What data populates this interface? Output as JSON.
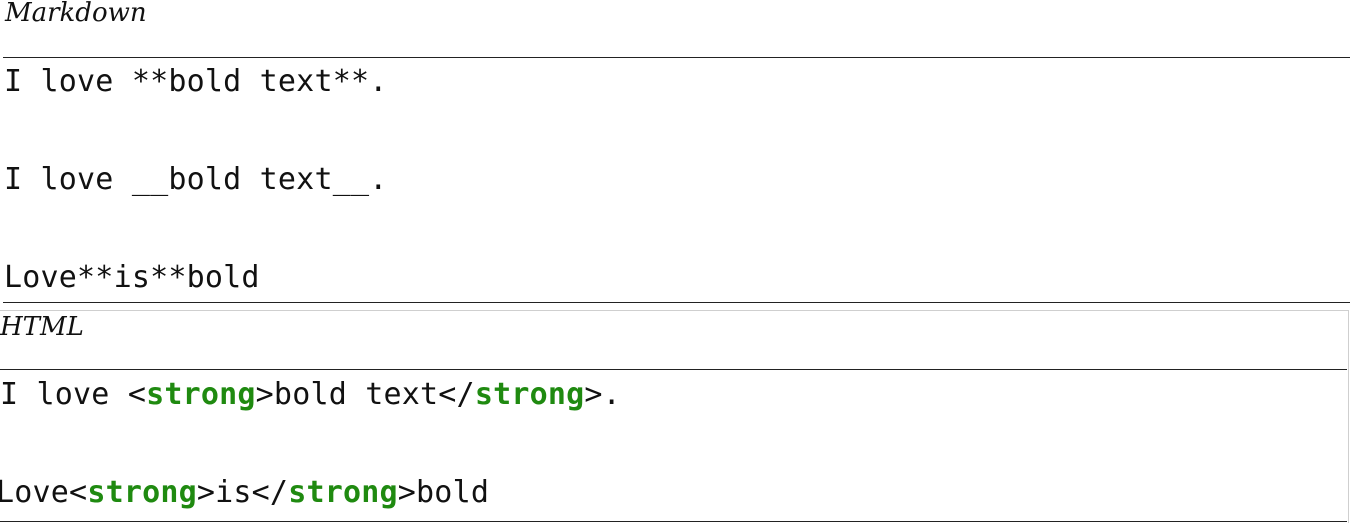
{
  "markdown_section": {
    "caption": "Markdown",
    "lines": [
      "I love **bold text**.",
      "I love __bold text__.",
      "Love**is**bold"
    ]
  },
  "html_section": {
    "caption": "HTML",
    "line1": {
      "part1": "I love <",
      "tag1": "strong",
      "part2": ">bold text</",
      "tag2": "strong",
      "part3": ">."
    },
    "line2": {
      "part1": "Love<",
      "tag1": "strong",
      "part2": ">is</",
      "tag2": "strong",
      "part3": ">bold"
    },
    "tag_color": "#1f8a10"
  }
}
